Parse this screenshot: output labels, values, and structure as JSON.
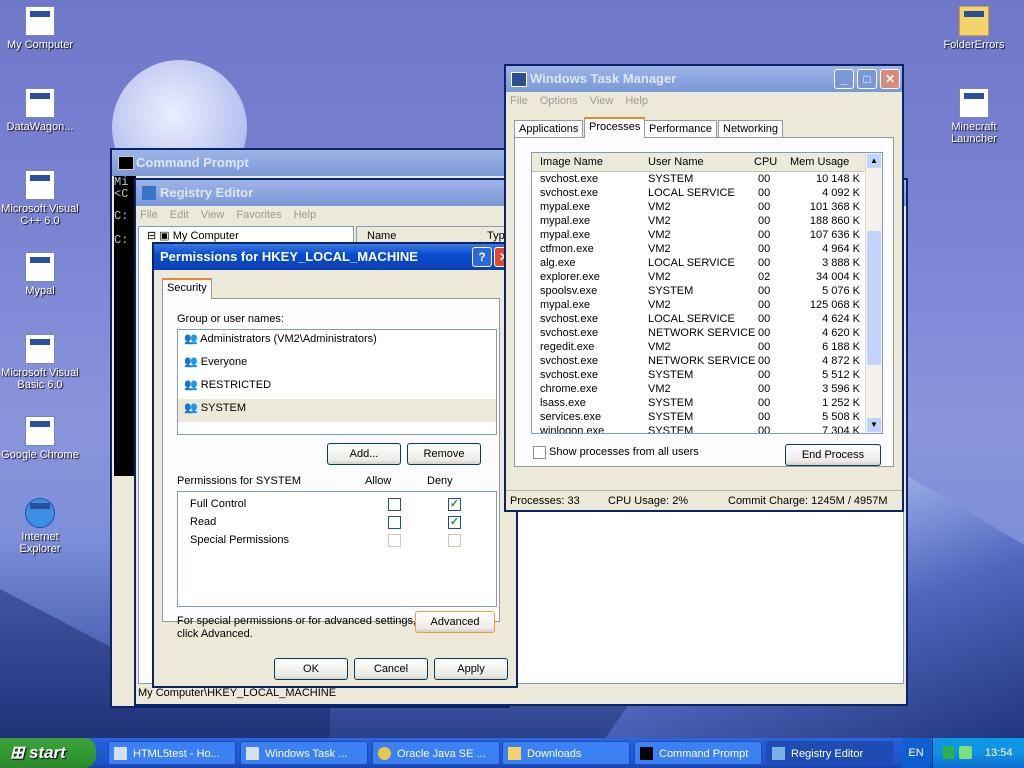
{
  "desktop": {
    "left_icons": [
      {
        "label": "My Computer",
        "icon": "my-computer-icon"
      },
      {
        "label": "DataWagon...",
        "icon": "program-icon"
      },
      {
        "label": "Microsoft Visual C++ 6.0",
        "icon": "program-icon"
      },
      {
        "label": "Mypal",
        "icon": "program-icon"
      },
      {
        "label": "Microsoft Visual Basic 6.0",
        "icon": "program-icon"
      },
      {
        "label": "Google Chrome",
        "icon": "program-icon"
      },
      {
        "label": "Internet Explorer",
        "icon": "internet-explorer-icon"
      }
    ],
    "right_icons": [
      {
        "label": "FolderErrors",
        "icon": "folder-icon"
      },
      {
        "label": "Minecraft Launcher",
        "icon": "program-icon"
      }
    ]
  },
  "cmd": {
    "title": "Command Prompt",
    "lines": [
      "Mi",
      "<C",
      "C:",
      "C:"
    ]
  },
  "regedit": {
    "title": "Registry Editor",
    "menu": [
      "File",
      "Edit",
      "View",
      "Favorites",
      "Help"
    ],
    "tree_root": "My Computer",
    "col_name": "Name",
    "col_type": "Typ",
    "status": "My Computer\\HKEY_LOCAL_MACHINE"
  },
  "perms": {
    "title": "Permissions for HKEY_LOCAL_MACHINE",
    "tab": "Security",
    "group_label": "Group or user names:",
    "users": [
      "Administrators (VM2\\Administrators)",
      "Everyone",
      "RESTRICTED",
      "SYSTEM"
    ],
    "add": "Add...",
    "remove": "Remove",
    "perm_label": "Permissions for SYSTEM",
    "allow": "Allow",
    "deny": "Deny",
    "perms": [
      {
        "name": "Full Control",
        "allow": false,
        "deny": true,
        "disabled": false
      },
      {
        "name": "Read",
        "allow": false,
        "deny": true,
        "disabled": false
      },
      {
        "name": "Special Permissions",
        "allow": false,
        "deny": false,
        "disabled": true
      }
    ],
    "special_text_1": "For special permissions or for advanced settings,",
    "special_text_2": "click Advanced.",
    "advanced": "Advanced",
    "ok": "OK",
    "cancel": "Cancel",
    "apply": "Apply"
  },
  "taskmgr": {
    "title": "Windows Task Manager",
    "menu": [
      "File",
      "Options",
      "View",
      "Help"
    ],
    "tabs": [
      "Applications",
      "Processes",
      "Performance",
      "Networking"
    ],
    "columns": [
      "Image Name",
      "User Name",
      "CPU",
      "Mem Usage"
    ],
    "rows": [
      [
        "svchost.exe",
        "SYSTEM",
        "00",
        "10 148 K"
      ],
      [
        "svchost.exe",
        "LOCAL SERVICE",
        "00",
        "4 092 K"
      ],
      [
        "mypal.exe",
        "VM2",
        "00",
        "101 368 K"
      ],
      [
        "mypal.exe",
        "VM2",
        "00",
        "188 860 K"
      ],
      [
        "mypal.exe",
        "VM2",
        "00",
        "107 636 K"
      ],
      [
        "ctfmon.exe",
        "VM2",
        "00",
        "4 964 K"
      ],
      [
        "alg.exe",
        "LOCAL SERVICE",
        "00",
        "3 888 K"
      ],
      [
        "explorer.exe",
        "VM2",
        "02",
        "34 004 K"
      ],
      [
        "spoolsv.exe",
        "SYSTEM",
        "00",
        "5 076 K"
      ],
      [
        "mypal.exe",
        "VM2",
        "00",
        "125 068 K"
      ],
      [
        "svchost.exe",
        "LOCAL SERVICE",
        "00",
        "4 624 K"
      ],
      [
        "svchost.exe",
        "NETWORK SERVICE",
        "00",
        "4 620 K"
      ],
      [
        "regedit.exe",
        "VM2",
        "00",
        "6 188 K"
      ],
      [
        "svchost.exe",
        "NETWORK SERVICE",
        "00",
        "4 872 K"
      ],
      [
        "svchost.exe",
        "SYSTEM",
        "00",
        "5 512 K"
      ],
      [
        "chrome.exe",
        "VM2",
        "00",
        "3 596 K"
      ],
      [
        "lsass.exe",
        "SYSTEM",
        "00",
        "1 252 K"
      ],
      [
        "services.exe",
        "SYSTEM",
        "00",
        "5 508 K"
      ],
      [
        "winlogon.exe",
        "SYSTEM",
        "00",
        "7 304 K"
      ]
    ],
    "show_all": "Show processes from all users",
    "end_process": "End Process",
    "status_processes": "Processes: 33",
    "status_cpu": "CPU Usage: 2%",
    "status_commit": "Commit Charge: 1245M / 4957M"
  },
  "taskbar": {
    "start": "start",
    "items": [
      "HTML5test - Ho...",
      "Windows Task ...",
      "Oracle Java SE ...",
      "Downloads",
      "Command Prompt",
      "Registry Editor"
    ],
    "lang": "EN",
    "clock": "13:54"
  },
  "colors": {
    "titlebar": "#0a4ccf",
    "start": "#35a035",
    "taskbar": "#245edb",
    "check": "#21a121"
  }
}
